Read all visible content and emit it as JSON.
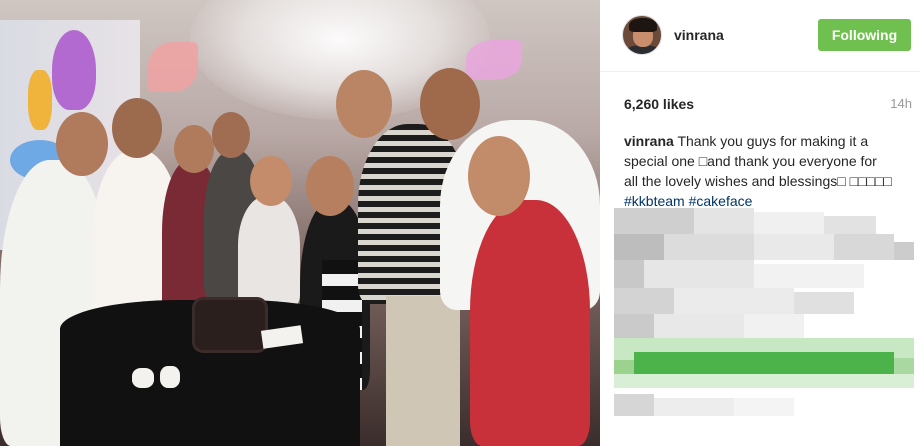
{
  "post": {
    "photo_alt": "Group photo at a birthday party",
    "author": {
      "username": "vinrana"
    },
    "follow_label": "Following",
    "likes": "6,260 likes",
    "time_ago": "14h",
    "caption": {
      "username": "vinrana",
      "text": "Thank you guys for making it a special one □and thank you everyone for all the lovely wishes and blessings□ □□□□□",
      "hashtags": [
        "#kkbteam",
        "#cakeface"
      ]
    }
  },
  "colors": {
    "follow_button": "#70c050",
    "hashtag": "#003569",
    "muted_text": "#999999"
  }
}
